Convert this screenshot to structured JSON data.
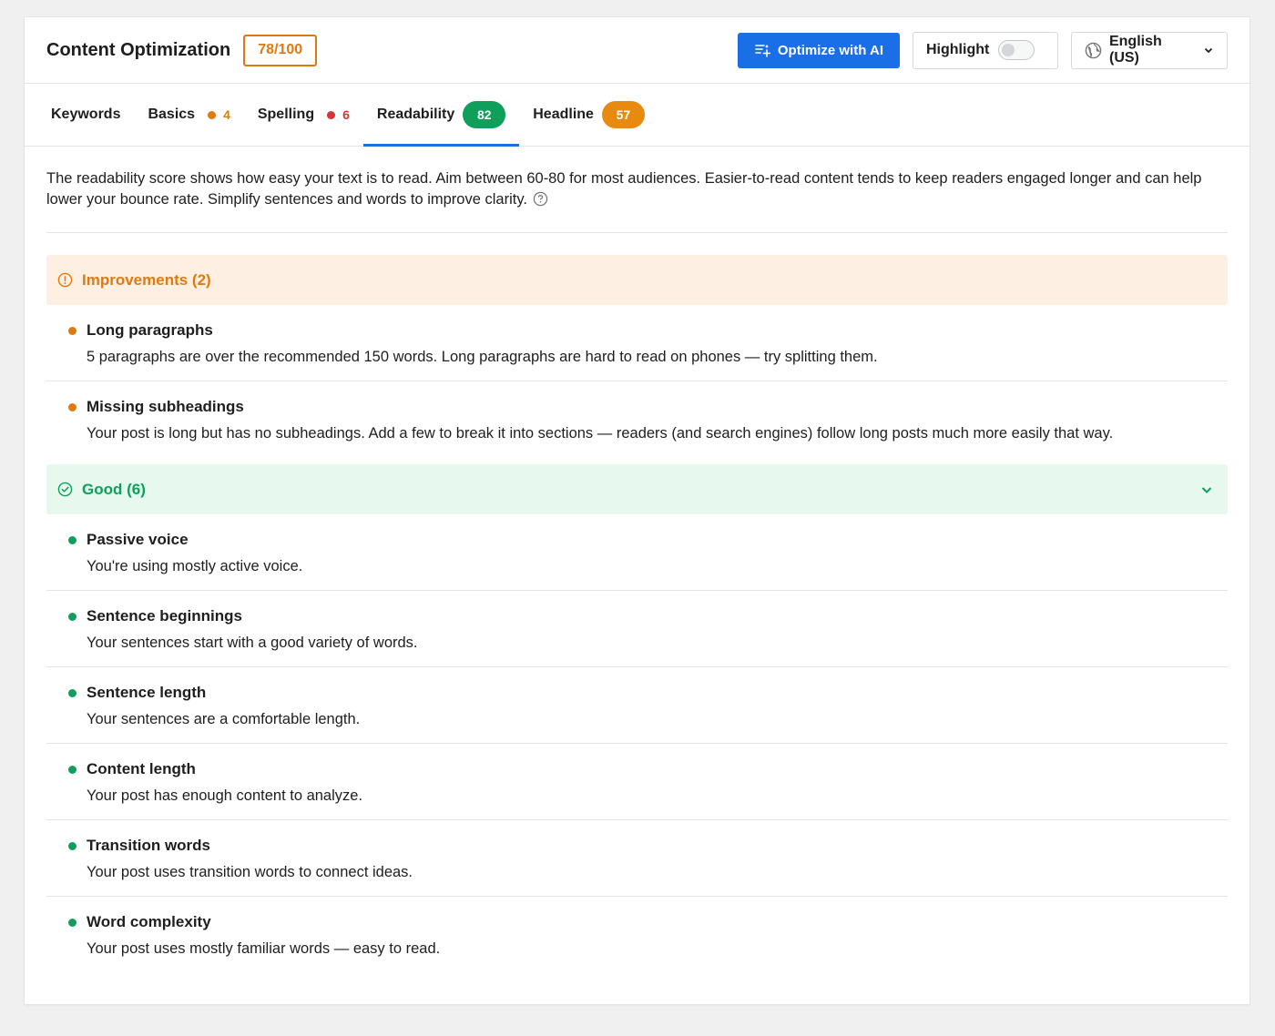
{
  "header": {
    "title": "Content Optimization",
    "score": "78/100",
    "optimize_label": "Optimize with AI",
    "highlight_label": "Highlight",
    "highlight_on": false,
    "language_label": "English (US)"
  },
  "tabs": [
    {
      "label": "Keywords"
    },
    {
      "label": "Basics",
      "count": "4",
      "color": "#e07a10"
    },
    {
      "label": "Spelling",
      "count": "6",
      "color": "#d63638"
    },
    {
      "label": "Readability",
      "score": "82",
      "color": "#0ea05a",
      "active": true
    },
    {
      "label": "Headline",
      "score": "57",
      "color": "#e07a10"
    }
  ],
  "intro": "The readability score shows how easy your text is to read. Aim between 60-80 for most audiences. Easier-to-read content tends to keep readers engaged longer and can help lower your bounce rate. Simplify sentences and words to improve clarity.",
  "improvements": {
    "heading": "Improvements (2)",
    "color": "#e07a10",
    "items": [
      {
        "title": "Long paragraphs",
        "desc": "5 paragraphs are over the recommended 150 words. Long paragraphs are hard to read on phones — try splitting them."
      },
      {
        "title": "Missing subheadings",
        "desc": "Your post is long but has no subheadings. Add a few to break it into sections — readers (and search engines) follow long posts much more easily that way."
      }
    ]
  },
  "good": {
    "heading": "Good (6)",
    "color": "#0ea05a",
    "items": [
      {
        "title": "Passive voice",
        "desc": "You're using mostly active voice."
      },
      {
        "title": "Sentence beginnings",
        "desc": "Your sentences start with a good variety of words."
      },
      {
        "title": "Sentence length",
        "desc": "Your sentences are a comfortable length."
      },
      {
        "title": "Content length",
        "desc": "Your post has enough content to analyze."
      },
      {
        "title": "Transition words",
        "desc": "Your post uses transition words to connect ideas."
      },
      {
        "title": "Word complexity",
        "desc": "Your post uses mostly familiar words — easy to read."
      }
    ]
  }
}
